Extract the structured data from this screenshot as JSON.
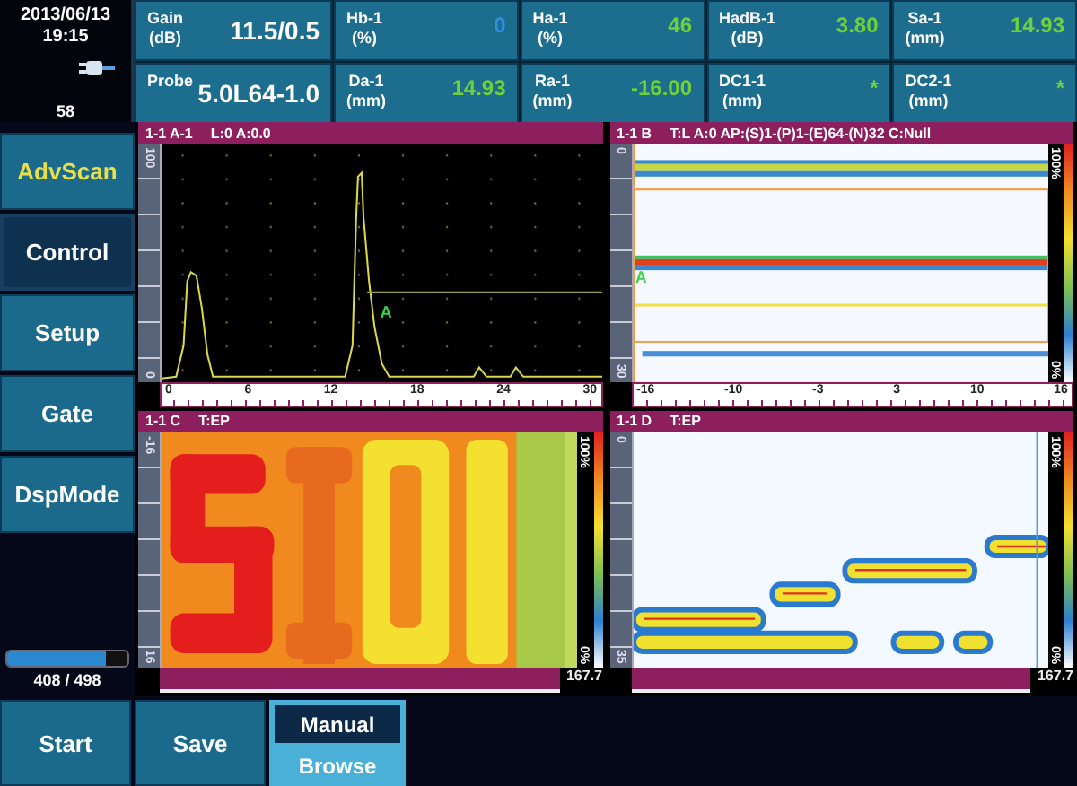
{
  "status": {
    "date": "2013/06/13",
    "time": "19:15",
    "counter": "58"
  },
  "readouts": [
    {
      "label": "Gain",
      "unit": "(dB)",
      "value": "11.5/0.5",
      "color": "#ffffff"
    },
    {
      "label": "Hb-1",
      "unit": "(%)",
      "value": "0",
      "color": "#2f8fe0"
    },
    {
      "label": "Ha-1",
      "unit": "(%)",
      "value": "46",
      "color": "#6fd13a"
    },
    {
      "label": "HadB-1",
      "unit": "(dB)",
      "value": "3.80",
      "color": "#6fd13a"
    },
    {
      "label": "Sa-1",
      "unit": "(mm)",
      "value": "14.93",
      "color": "#6fd13a"
    },
    {
      "label": "Probe",
      "value": "5.0L64-1.0",
      "color": "#ffffff"
    },
    {
      "label": "Da-1",
      "unit": "(mm)",
      "value": "14.93",
      "color": "#6fd13a"
    },
    {
      "label": "Ra-1",
      "unit": "(mm)",
      "value": "-16.00",
      "color": "#6fd13a"
    },
    {
      "label": "DC1-1",
      "unit": "(mm)",
      "value": "*",
      "color": "#6fd13a"
    },
    {
      "label": "DC2-1",
      "unit": "(mm)",
      "value": "*",
      "color": "#6fd13a"
    }
  ],
  "menu": [
    {
      "label": "AdvScan",
      "selected": false,
      "highlighted": true
    },
    {
      "label": "Control",
      "selected": true,
      "highlighted": false
    },
    {
      "label": "Setup",
      "selected": false,
      "highlighted": false
    },
    {
      "label": "Gate",
      "selected": false,
      "highlighted": false
    },
    {
      "label": "DspMode",
      "selected": false,
      "highlighted": false
    }
  ],
  "progress": {
    "level": 0.82,
    "reading": "408 / 498"
  },
  "views": [
    {
      "kind": "ascan",
      "title": "1-1 A-1",
      "info": "L:0 A:0.0",
      "y_ticks": [
        "100",
        "0"
      ],
      "x_ticks": [
        "0",
        "6",
        "12",
        "18",
        "24",
        "30"
      ],
      "marker": "A"
    },
    {
      "kind": "bscan",
      "title": "1-1 B",
      "info": "T:L A:0 AP:(S)1-(P)1-(E)64-(N)32 C:Null",
      "y_ticks": [
        "0",
        "30"
      ],
      "x_ticks": [
        "-16",
        "-10",
        "-3",
        "3",
        "10",
        "16"
      ],
      "marker": "A",
      "scale": [
        "100%",
        "0%"
      ]
    },
    {
      "kind": "cscan",
      "title": "1-1 C",
      "info": "T:EP",
      "y_ticks": [
        "-16",
        "16"
      ],
      "scale": [
        "100%",
        "0%"
      ],
      "end_label": "167.7"
    },
    {
      "kind": "dscan",
      "title": "1-1 D",
      "info": "T:EP",
      "y_ticks": [
        "0",
        "35"
      ],
      "scale": [
        "100%",
        "0%"
      ],
      "end_label": "167.7"
    }
  ],
  "buttons": [
    {
      "label": "Start"
    },
    {
      "label": "Save"
    }
  ],
  "mode_toggle": [
    {
      "label": "Manual",
      "selected": true
    },
    {
      "label": "Browse",
      "selected": false
    }
  ]
}
